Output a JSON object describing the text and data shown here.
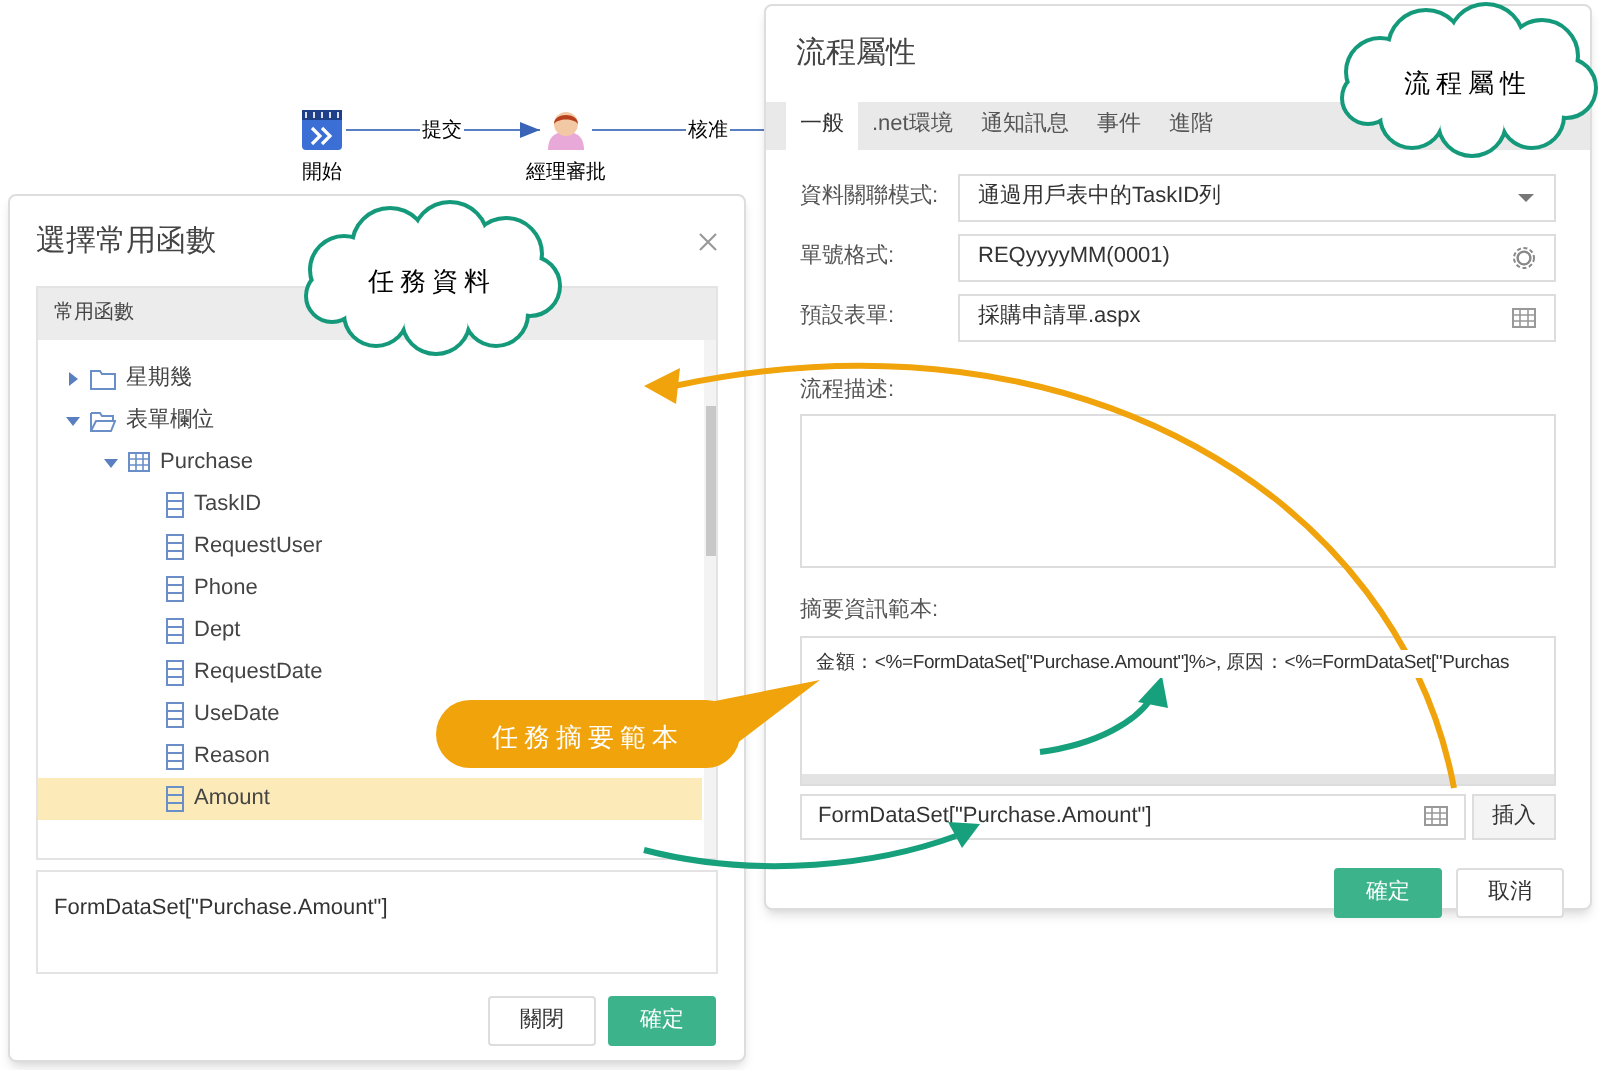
{
  "canvas": {
    "nodes": [
      {
        "kind": "start",
        "label": "開始"
      },
      {
        "kind": "user",
        "label": "經理審批"
      }
    ],
    "edges": [
      {
        "label": "提交"
      },
      {
        "label": "核准"
      }
    ]
  },
  "flow_properties_dialog": {
    "title": "流程屬性",
    "tabs": [
      {
        "label": "一般",
        "selected": true
      },
      {
        "label": ".net環境",
        "selected": false
      },
      {
        "label": "通知訊息",
        "selected": false
      },
      {
        "label": "事件",
        "selected": false
      },
      {
        "label": "進階",
        "selected": false
      }
    ],
    "fields": [
      {
        "label": "資料關聯模式:",
        "value": "通過用戶表中的TaskID列",
        "kind": "select"
      },
      {
        "label": "單號格式:",
        "value": "REQyyyyMM(0001)",
        "kind": "gear"
      },
      {
        "label": "預設表單:",
        "value": "採購申請單.aspx",
        "kind": "picker"
      }
    ],
    "description": {
      "label": "流程描述:"
    },
    "summary_template": {
      "label": "摘要資訊範本:",
      "value": "金額：<%=FormDataSet[\"Purchase.Amount\"]%>, 原因：<%=FormDataSet[\"Purchas"
    },
    "expression_field": {
      "value": "FormDataSet[\"Purchase.Amount\"]"
    },
    "insert_button": "插入",
    "buttons": [
      {
        "label": "確定",
        "primary": true
      },
      {
        "label": "取消",
        "primary": false
      }
    ]
  },
  "select_function_dialog": {
    "title": "選擇常用函數",
    "panel_header": "常用函數",
    "tree": [
      {
        "label": "星期幾",
        "kind": "folder",
        "expanded": false
      },
      {
        "label": "表單欄位",
        "kind": "folder",
        "expanded": true,
        "children": [
          {
            "label": "Purchase",
            "kind": "table",
            "expanded": true,
            "children": [
              {
                "label": "TaskID",
                "kind": "field",
                "selected": false
              },
              {
                "label": "RequestUser",
                "kind": "field",
                "selected": false
              },
              {
                "label": "Phone",
                "kind": "field",
                "selected": false
              },
              {
                "label": "Dept",
                "kind": "field",
                "selected": false
              },
              {
                "label": "RequestDate",
                "kind": "field",
                "selected": false
              },
              {
                "label": "UseDate",
                "kind": "field",
                "selected": false
              },
              {
                "label": "Reason",
                "kind": "field",
                "selected": false
              },
              {
                "label": "Amount",
                "kind": "field",
                "selected": true
              }
            ]
          }
        ]
      }
    ],
    "expression": "FormDataSet[\"Purchase.Amount\"]",
    "buttons": [
      {
        "label": "關閉",
        "primary": false
      },
      {
        "label": "確定",
        "primary": true
      }
    ]
  },
  "annotations": {
    "clouds": [
      "流程屬性",
      "任務資料"
    ],
    "bubble": "任務摘要範本"
  }
}
